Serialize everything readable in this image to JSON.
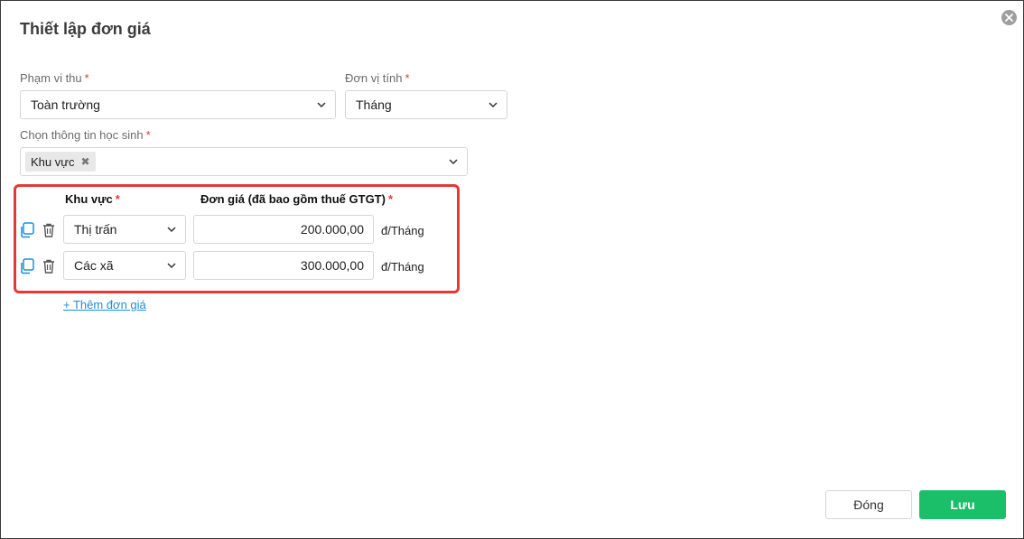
{
  "dialog": {
    "title": "Thiết lập đơn giá"
  },
  "form": {
    "scope": {
      "label": "Phạm vi thu",
      "required_mark": "*",
      "value": "Toàn trường"
    },
    "unit": {
      "label": "Đơn vị tính",
      "required_mark": "*",
      "value": "Tháng"
    },
    "student_info": {
      "label": "Chọn thông tin học sinh",
      "required_mark": "*",
      "tags": [
        "Khu vực"
      ]
    }
  },
  "price_table": {
    "headers": {
      "area": "Khu vực",
      "price": "Đơn giá (đã bao gồm thuế GTGT)",
      "required_mark": "*"
    },
    "rows": [
      {
        "area": "Thị trấn",
        "price": "200.000,00",
        "unit": "đ/Tháng"
      },
      {
        "area": "Các xã",
        "price": "300.000,00",
        "unit": "đ/Tháng"
      }
    ],
    "add_link": "+ Thêm đơn giá"
  },
  "footer": {
    "close_label": "Đóng",
    "save_label": "Lưu"
  },
  "colors": {
    "accent_green": "#1bbf6a",
    "highlight_red": "#e53935",
    "link_blue": "#1a8fd8",
    "copy_icon_blue": "#1a8fd8"
  },
  "icons": [
    "close-circle-icon",
    "chevron-down-icon",
    "copy-icon",
    "trash-icon",
    "tag-remove-icon"
  ]
}
